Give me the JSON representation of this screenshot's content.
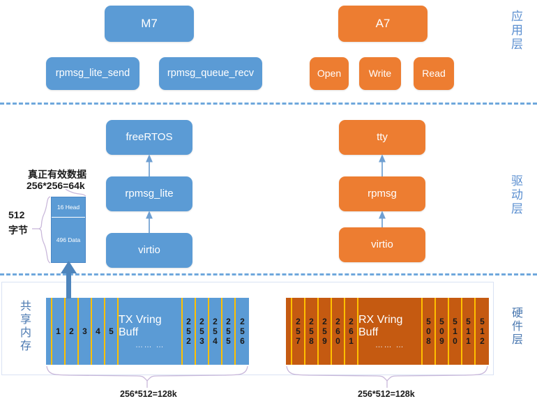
{
  "layers": {
    "application": "应用层",
    "driver": "驱动层",
    "hardware": "硬件层"
  },
  "app_layer": {
    "m7": "M7",
    "a7": "A7",
    "m7_calls": [
      "rpmsg_lite_send",
      "rpmsg_queue_recv"
    ],
    "a7_calls": [
      "Open",
      "Write",
      "Read"
    ]
  },
  "driver_layer": {
    "m7_stack": [
      "freeRTOS",
      "rpmsg_lite",
      "virtio"
    ],
    "a7_stack": [
      "tty",
      "rpmsg",
      "virtio"
    ]
  },
  "buffer_detail": {
    "title_line1": "真正有效数据",
    "title_line2": "256*256=64k",
    "size_line1": "512",
    "size_line2": "字节",
    "head": "16 Head",
    "data": "496 Data"
  },
  "hardware_layer": {
    "shared_memory_label": "共享内存",
    "tx": {
      "name": "TX Vring Buff",
      "dots": "…… …",
      "head_cells": [
        "1",
        "2",
        "3",
        "4",
        "5"
      ],
      "tail_cells": [
        "252",
        "253",
        "254",
        "255",
        "256"
      ],
      "total_label": "256*512=128k"
    },
    "rx": {
      "name": "RX Vring Buff",
      "dots": "…… …",
      "head_cells": [
        "257",
        "258",
        "259",
        "260",
        "261"
      ],
      "tail_cells": [
        "508",
        "509",
        "510",
        "511",
        "512"
      ],
      "total_label": "256*512=128k"
    }
  },
  "colors": {
    "blue": "#5B9BD5",
    "orange": "#ED7D31",
    "rx_orange": "#C55A11",
    "divider": "#6FA8DC",
    "cell_separator": "#FFC000",
    "brace": "#C9B8DA",
    "layer_label": "#5B8FD0"
  }
}
